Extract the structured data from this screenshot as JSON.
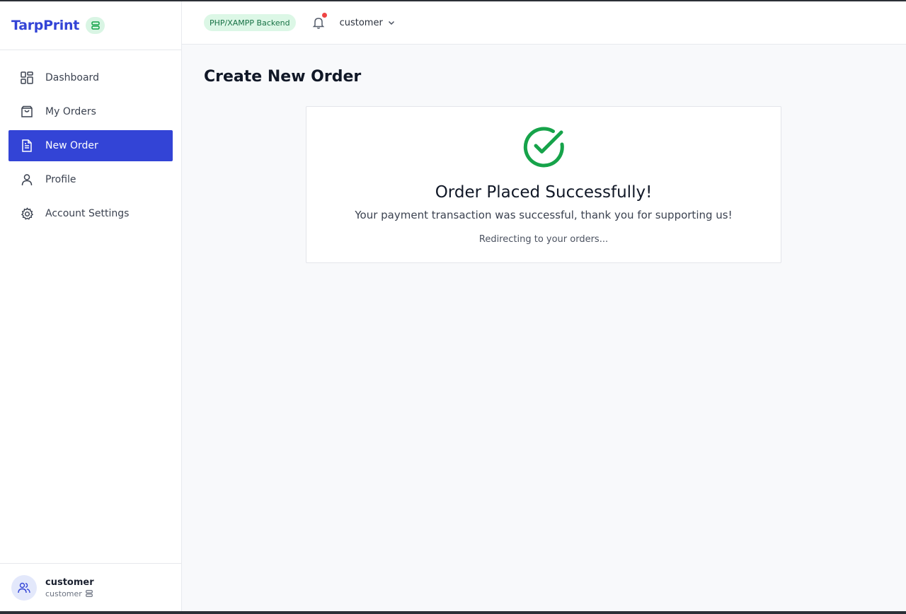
{
  "brand": {
    "name": "TarpPrint",
    "badge_icon": "database-icon"
  },
  "sidebar": {
    "items": [
      {
        "label": "Dashboard",
        "icon": "dashboard-grid-icon",
        "active": false
      },
      {
        "label": "My Orders",
        "icon": "shopping-bag-icon",
        "active": false
      },
      {
        "label": "New Order",
        "icon": "file-text-icon",
        "active": true
      },
      {
        "label": "Profile",
        "icon": "user-icon",
        "active": false
      },
      {
        "label": "Account Settings",
        "icon": "gear-icon",
        "active": false
      }
    ],
    "user": {
      "name": "customer",
      "role": "customer"
    }
  },
  "topbar": {
    "backend_label": "PHP/XAMPP Backend",
    "user_menu_label": "customer",
    "has_notification": true
  },
  "page": {
    "title": "Create New Order",
    "success": {
      "title": "Order Placed Successfully!",
      "message": "Your payment transaction was successful, thank you for supporting us!",
      "redirect_note": "Redirecting to your orders..."
    }
  },
  "colors": {
    "accent": "#3344d6",
    "success": "#16a34a",
    "notification_dot": "#ef4444",
    "backend_pill_bg": "#dcf7e6"
  }
}
